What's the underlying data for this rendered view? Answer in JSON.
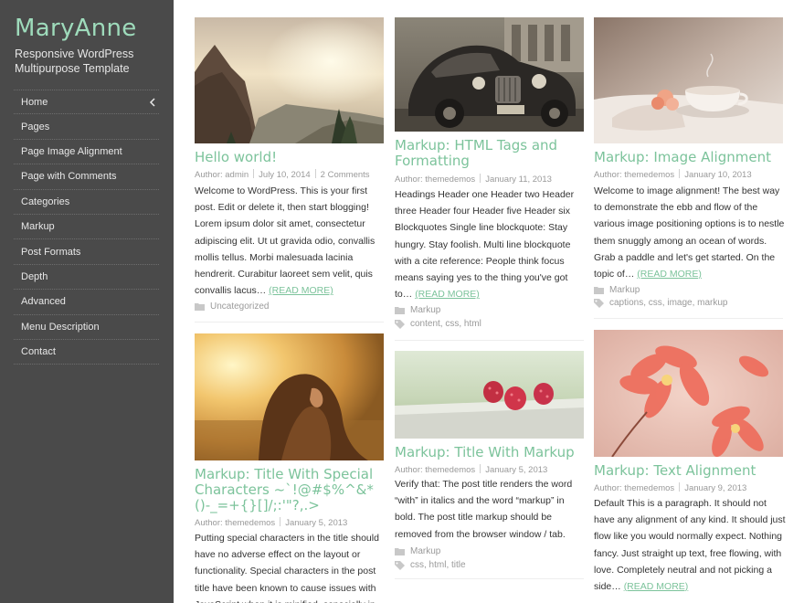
{
  "site": {
    "title": "MaryAnne",
    "description": "Responsive WordPress Multipurpose Template"
  },
  "menu": [
    {
      "label": "Home"
    },
    {
      "label": "Pages"
    },
    {
      "label": "Page Image Alignment"
    },
    {
      "label": "Page with Comments"
    },
    {
      "label": "Categories"
    },
    {
      "label": "Markup"
    },
    {
      "label": "Post Formats"
    },
    {
      "label": "Depth"
    },
    {
      "label": "Advanced"
    },
    {
      "label": "Menu Description"
    },
    {
      "label": "Contact"
    }
  ],
  "posts": {
    "hello": {
      "title": "Hello world!",
      "author": "Author: admin",
      "date": "July 10, 2014",
      "comments": "2 Comments",
      "excerpt": "Welcome to WordPress. This is your first post. Edit or delete it, then start blogging! Lorem ipsum dolor sit amet, consectetur adipiscing elit. Ut ut gravida odio, convallis mollis tellus. Morbi malesuada lacinia hendrerit. Curabitur laoreet sem velit, quis convallis lacus…",
      "readmore": "(READ MORE)",
      "category": "Uncategorized"
    },
    "html_tags": {
      "title": "Markup: HTML Tags and Formatting",
      "author": "Author: themedemos",
      "date": "January 11, 2013",
      "excerpt": "Headings Header one Header two Header three Header four Header five Header six Blockquotes Single line blockquote: Stay hungry. Stay foolish. Multi line blockquote with a cite reference: People think focus means saying yes to the thing you've got to…",
      "readmore": "(READ MORE)",
      "category": "Markup",
      "tags": "content, css, html"
    },
    "image_align": {
      "title": "Markup: Image Alignment",
      "author": "Author: themedemos",
      "date": "January 10, 2013",
      "excerpt": "Welcome to image alignment! The best way to demonstrate the ebb and flow of the various image positioning options is to nestle them snuggly among an ocean of words. Grab a paddle and let's get started. On the topic of…",
      "readmore": "(READ MORE)",
      "category": "Markup",
      "tags": "captions, css, image, markup"
    },
    "special_chars": {
      "title": "Markup: Title With Special Characters ~`!@#$%^&*()-_=+{}[]/;:'\"?,.>",
      "author": "Author: themedemos",
      "date": "January 5, 2013",
      "excerpt": "Putting special characters in the title should have no adverse effect on the layout or functionality. Special characters in the post title have been known to cause issues with JavaScript when it is minified, especially in the"
    },
    "title_markup": {
      "title": "Markup: Title With Markup",
      "author": "Author: themedemos",
      "date": "January 5, 2013",
      "excerpt": "Verify that: The post title renders the word “with” in italics and the word “markup” in bold. The post title markup should be removed from the browser window / tab.",
      "category": "Markup",
      "tags": "css, html, title"
    },
    "text_align": {
      "title": "Markup: Text Alignment",
      "author": "Author: themedemos",
      "date": "January 9, 2013",
      "excerpt": "Default This is a paragraph. It should not have any alignment of any kind. It should just flow like you would normally expect. Nothing fancy. Just straight up text, free flowing, with love. Completely neutral and not picking a side…",
      "readmore": "(READ MORE)",
      "category": "Markup"
    }
  },
  "icons": {
    "menu_chevron": "chevron-left-icon",
    "category": "folder-icon",
    "tags": "tag-icon"
  },
  "colors": {
    "accent": "#7cc39b",
    "sidebar_bg": "#4a4a4a",
    "site_title": "#9edbbb"
  }
}
